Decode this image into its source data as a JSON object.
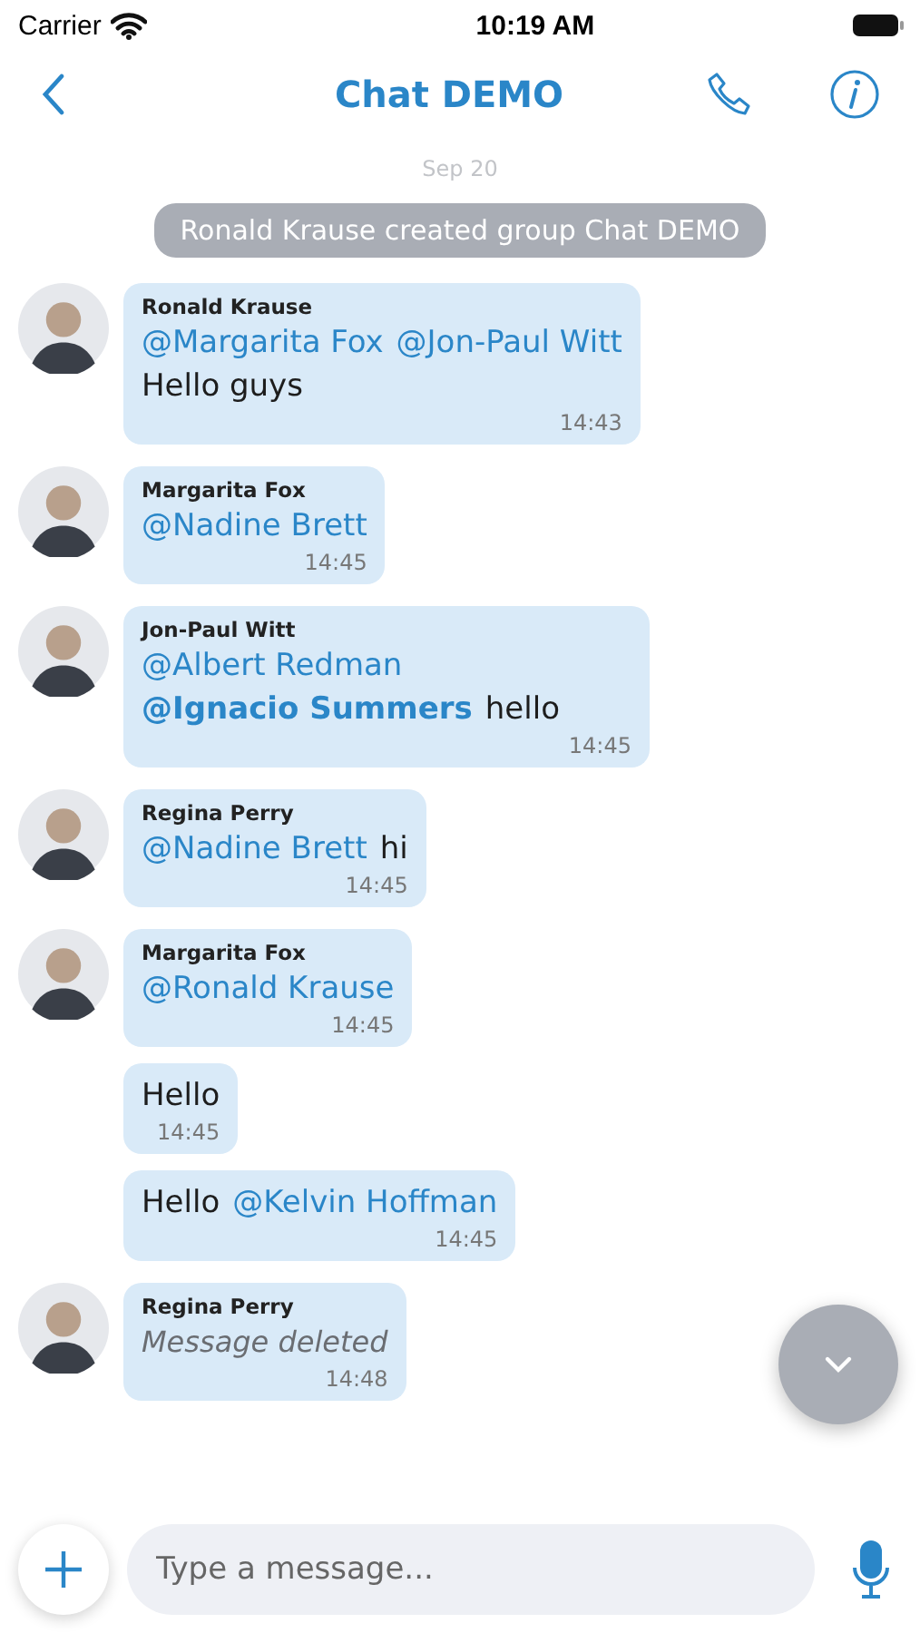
{
  "status_bar": {
    "carrier": "Carrier",
    "time": "10:19 AM"
  },
  "header": {
    "title": "Chat DEMO"
  },
  "date_separator": "Sep 20",
  "system_message": "Ronald Krause created group Chat DEMO",
  "messages": [
    {
      "kind": "text",
      "sender": "Ronald Krause",
      "lines": [
        [
          {
            "text": "@Margarita Fox",
            "kind": "mention"
          },
          {
            "text": "@Jon-Paul Witt",
            "kind": "mention"
          }
        ],
        [
          {
            "text": "Hello guys",
            "kind": "plain"
          }
        ]
      ],
      "time": "14:43"
    },
    {
      "kind": "text",
      "sender": "Margarita Fox",
      "lines": [
        [
          {
            "text": "@Nadine Brett",
            "kind": "mention"
          }
        ]
      ],
      "time": "14:45"
    },
    {
      "kind": "text",
      "sender": "Jon-Paul Witt",
      "lines": [
        [
          {
            "text": "@Albert Redman",
            "kind": "mention"
          },
          {
            "text": "@Ignacio Summers",
            "kind": "strong_mention"
          },
          {
            "text": "hello",
            "kind": "plain"
          }
        ]
      ],
      "time": "14:45"
    },
    {
      "kind": "text",
      "sender": "Regina Perry",
      "lines": [
        [
          {
            "text": "@Nadine Brett",
            "kind": "mention"
          },
          {
            "text": "hi",
            "kind": "plain"
          }
        ]
      ],
      "time": "14:45"
    },
    {
      "kind": "text",
      "sender": "Margarita Fox",
      "lines": [
        [
          {
            "text": "@Ronald Krause",
            "kind": "mention"
          }
        ]
      ],
      "time": "14:45"
    },
    {
      "kind": "text",
      "lines": [
        [
          {
            "text": "Hello",
            "kind": "plain"
          }
        ]
      ],
      "time": "14:45"
    },
    {
      "kind": "text",
      "lines": [
        [
          {
            "text": "Hello",
            "kind": "plain"
          },
          {
            "text": "@Kelvin Hoffman",
            "kind": "mention"
          }
        ]
      ],
      "time": "14:45"
    },
    {
      "kind": "deleted",
      "sender": "Regina Perry",
      "text": "Message deleted",
      "time": "14:48"
    }
  ],
  "composer": {
    "placeholder": "Type a message..."
  }
}
